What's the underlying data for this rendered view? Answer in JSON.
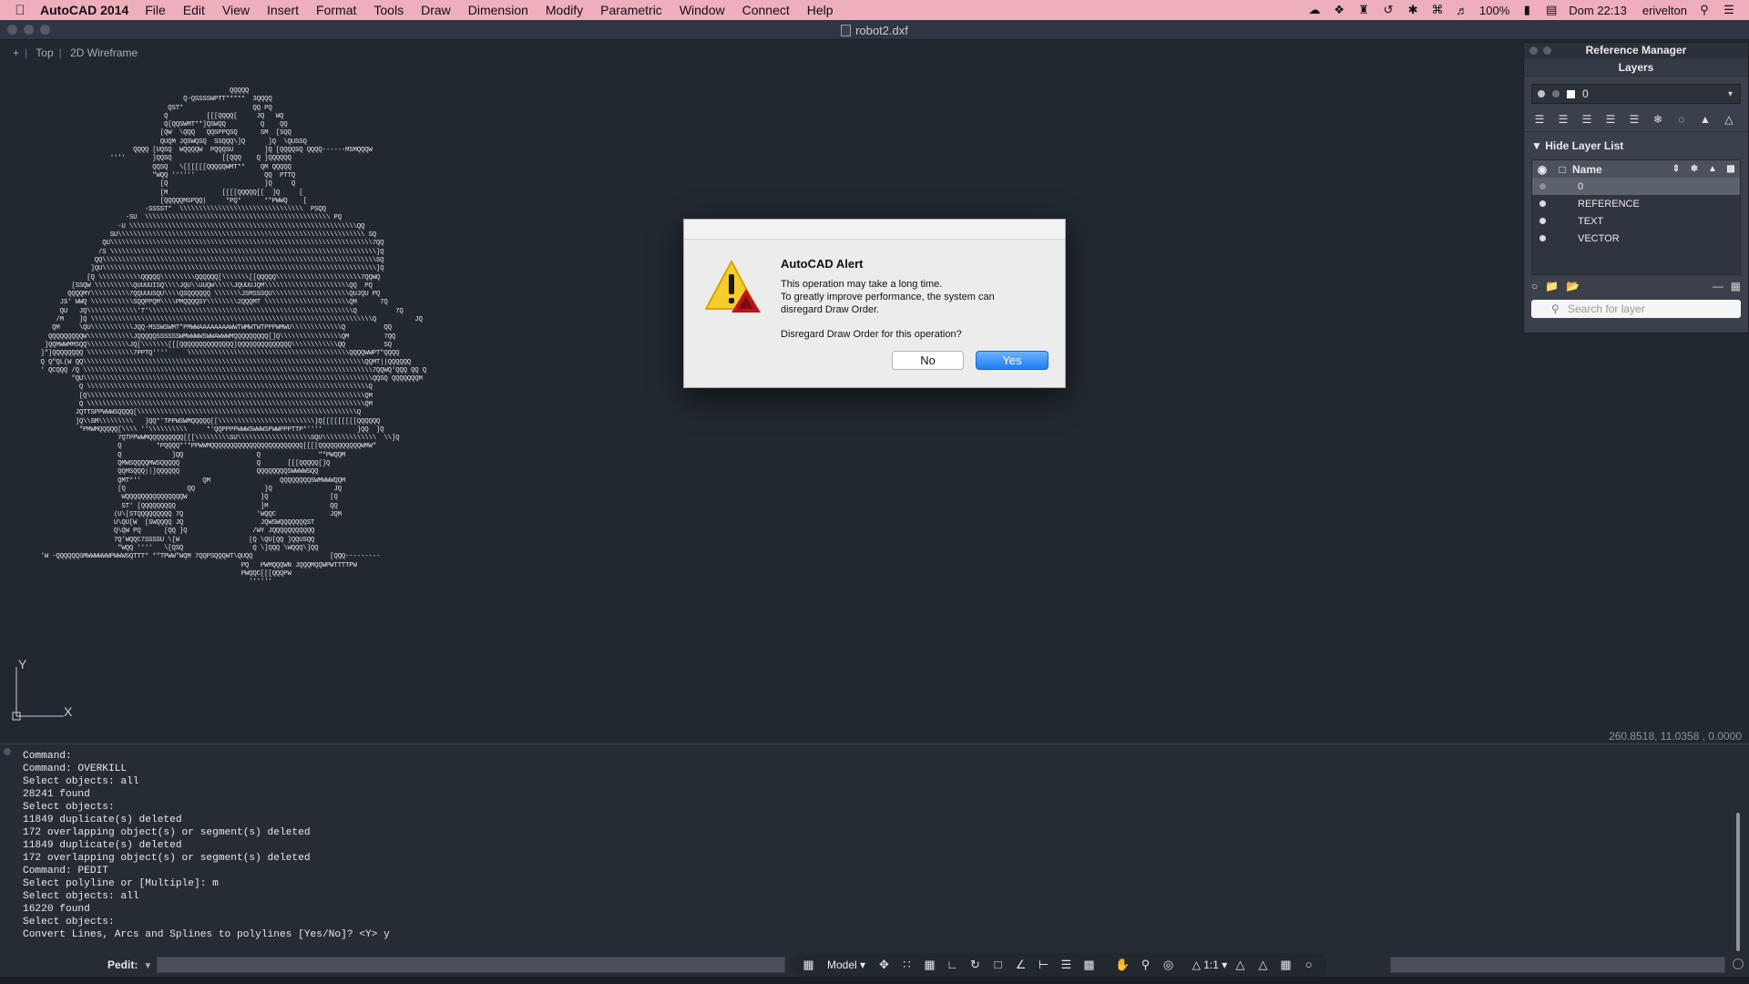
{
  "menubar": {
    "app_name": "AutoCAD 2014",
    "items": [
      "File",
      "Edit",
      "View",
      "Insert",
      "Format",
      "Tools",
      "Draw",
      "Dimension",
      "Modify",
      "Parametric",
      "Window",
      "Connect",
      "Help"
    ],
    "battery": "100%",
    "clock": "Dom 22:13",
    "user": "erivelton"
  },
  "window": {
    "title": "robot2.dxf"
  },
  "viewport": {
    "nav": "+",
    "view": "Top",
    "style": "2D Wireframe"
  },
  "coordinates": "260.8518, 11.0358 , 0.0000",
  "ucs": {
    "x_label": "X",
    "y_label": "Y"
  },
  "palette": {
    "title": "Reference Manager",
    "layers_title": "Layers",
    "current_layer": "0",
    "hide_list_label": "Hide Layer List",
    "column_name": "Name",
    "layers": [
      "0",
      "REFERENCE",
      "TEXT",
      "VECTOR"
    ],
    "search_placeholder": "Search for layer"
  },
  "alert": {
    "title": "AutoCAD Alert",
    "line1": "This operation may take a long time.",
    "line2": "To greatly improve performance, the system can",
    "line3": "disregard Draw Order.",
    "question": "Disregard Draw Order for this operation?",
    "no_label": "No",
    "yes_label": "Yes"
  },
  "command_history": [
    "Command:",
    "Command: OVERKILL",
    "Select objects: all",
    "28241 found",
    "Select objects:",
    "11849 duplicate(s) deleted",
    "172 overlapping object(s) or segment(s) deleted",
    "11849 duplicate(s) deleted",
    "172 overlapping object(s) or segment(s) deleted",
    "Command: PEDIT",
    "Select polyline or [Multiple]: m",
    "Select objects: all",
    "16220 found",
    "Select objects:",
    "Convert Lines, Arcs and Splines to polylines [Yes/No]? <Y> y"
  ],
  "statusbar": {
    "prompt_label": "Pedit:",
    "model_label": "Model",
    "scale_label": "1:1"
  },
  "colors": {
    "menubar": "#eeaebb",
    "canvas": "#212830",
    "accent_button": "#1e7cf3"
  }
}
